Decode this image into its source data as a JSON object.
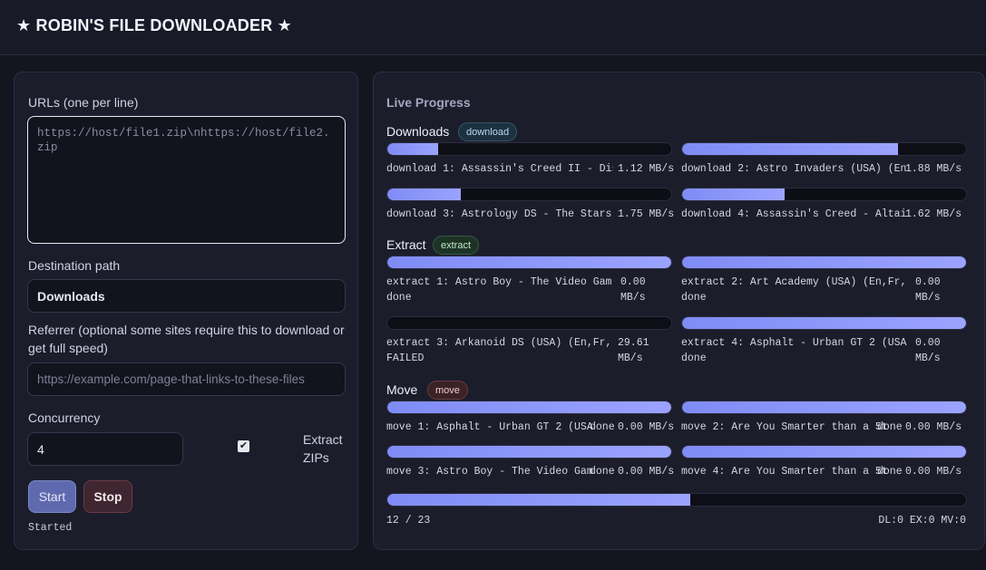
{
  "app": {
    "title": "★ ROBIN'S FILE DOWNLOADER ★"
  },
  "form": {
    "urls_label": "URLs (one per line)",
    "urls_placeholder": "https://host/file1.zip\\nhttps://host/file2.zip",
    "dest_label": "Destination path",
    "dest_value": "Downloads",
    "referrer_label": "Referrer (optional some sites require this to download or get full speed)",
    "referrer_placeholder": "https://example.com/page-that-links-to-these-files",
    "concurrency_label": "Concurrency",
    "concurrency_value": "4",
    "extract_zips_label": "Extract ZIPs",
    "extract_zips_checked": true,
    "start_label": "Start",
    "stop_label": "Stop",
    "status": "Started"
  },
  "progress": {
    "title": "Live Progress",
    "sections": {
      "downloads": {
        "title": "Downloads",
        "badge": "download",
        "items": [
          {
            "name": "download 1: Assassin's Creed II - Dis",
            "state": "",
            "speed": "1.12 MB/s",
            "progress": 0.18
          },
          {
            "name": "download 2: Astro Invaders (USA) (En,",
            "state": "",
            "speed": "1.88 MB/s",
            "progress": 0.76
          },
          {
            "name": "download 3: Astrology DS - The Stars",
            "state": "",
            "speed": "1.75 MB/s",
            "progress": 0.26
          },
          {
            "name": "download 4: Assassin's Creed - Altair",
            "state": "",
            "speed": "1.62 MB/s",
            "progress": 0.36
          }
        ]
      },
      "extract": {
        "title": "Extract",
        "badge": "extract",
        "items": [
          {
            "name": "extract 1: Astro Boy - The Video Gam",
            "state": "done",
            "speed": "0.00 MB/s",
            "progress": 1.0
          },
          {
            "name": "extract 2: Art Academy (USA) (En,Fr,",
            "state": "done",
            "speed": "0.00 MB/s",
            "progress": 1.0
          },
          {
            "name": "extract 3: Arkanoid DS (USA) (En,Fr,",
            "state": "FAILED",
            "speed": "29.61 MB/s",
            "progress": 0.0
          },
          {
            "name": "extract 4: Asphalt - Urban GT 2 (USA",
            "state": "done",
            "speed": "0.00 MB/s",
            "progress": 1.0
          }
        ]
      },
      "move": {
        "title": "Move",
        "badge": "move",
        "items": [
          {
            "name": "move 1: Asphalt - Urban GT 2 (USA",
            "state": "done",
            "speed": "0.00 MB/s",
            "progress": 1.0
          },
          {
            "name": "move 2: Are You Smarter than a 5t",
            "state": "done",
            "speed": "0.00 MB/s",
            "progress": 1.0
          },
          {
            "name": "move 3: Astro Boy - The Video Gam",
            "state": "done",
            "speed": "0.00 MB/s",
            "progress": 1.0
          },
          {
            "name": "move 4: Are You Smarter than a 5t",
            "state": "done",
            "speed": "0.00 MB/s",
            "progress": 1.0
          }
        ]
      }
    },
    "overall": {
      "count": "12 / 23",
      "counters": "DL:0 EX:0 MV:0",
      "progress": 0.5234
    }
  },
  "colors": {
    "accent": "#8b95f8",
    "background": "#14151f",
    "panel": "#1c1d2b"
  }
}
